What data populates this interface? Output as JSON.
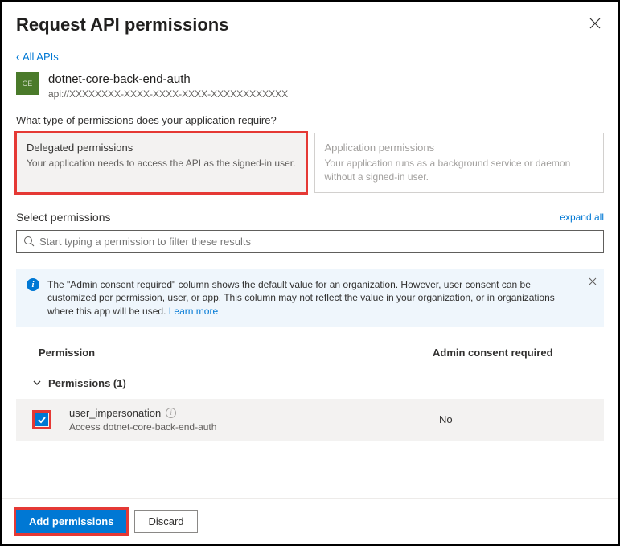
{
  "header": {
    "title": "Request API permissions"
  },
  "breadcrumb": {
    "back": "All APIs"
  },
  "api": {
    "icon_text": "CE",
    "name": "dotnet-core-back-end-auth",
    "uri": "api://XXXXXXXX-XXXX-XXXX-XXXX-XXXXXXXXXXXX"
  },
  "question": "What type of permissions does your application require?",
  "permission_types": {
    "delegated": {
      "title": "Delegated permissions",
      "desc": "Your application needs to access the API as the signed-in user."
    },
    "application": {
      "title": "Application permissions",
      "desc": "Your application runs as a background service or daemon without a signed-in user."
    }
  },
  "select": {
    "label": "Select permissions",
    "expand_all": "expand all"
  },
  "search": {
    "placeholder": "Start typing a permission to filter these results"
  },
  "info": {
    "text": "The \"Admin consent required\" column shows the default value for an organization. However, user consent can be customized per permission, user, or app. This column may not reflect the value in your organization, or in organizations where this app will be used.  ",
    "link": "Learn more"
  },
  "table": {
    "cols": {
      "permission": "Permission",
      "admin": "Admin consent required"
    },
    "group": "Permissions (1)",
    "row": {
      "name": "user_impersonation",
      "desc": "Access dotnet-core-back-end-auth",
      "admin": "No",
      "checked": true
    }
  },
  "footer": {
    "add": "Add permissions",
    "discard": "Discard"
  }
}
